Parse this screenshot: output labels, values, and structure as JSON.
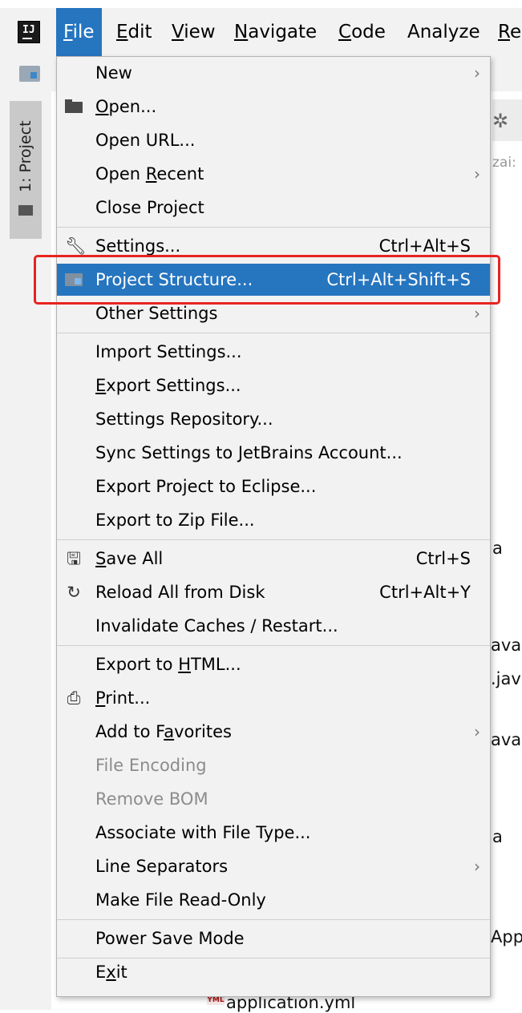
{
  "menubar": {
    "logo": "IJ",
    "items": [
      {
        "label": "File",
        "mnemonic": "F",
        "rest": "ile"
      },
      {
        "label": "Edit",
        "mnemonic": "E",
        "rest": "dit"
      },
      {
        "label": "View",
        "mnemonic": "V",
        "rest": "iew"
      },
      {
        "label": "Navigate",
        "mnemonic": "N",
        "rest": "avigate"
      },
      {
        "label": "Code",
        "mnemonic": "C",
        "rest": "ode"
      },
      {
        "label": "Analyze",
        "mnemonic": "",
        "rest": "Analyze"
      },
      {
        "label": "Re",
        "mnemonic": "R",
        "rest": "e"
      }
    ]
  },
  "side_panel": {
    "tab_label": "1: Project"
  },
  "background": {
    "muted_text": "zai:",
    "fragments": [
      "a",
      "ava",
      ".jav",
      "ava",
      "a",
      "App"
    ],
    "bottom_file": "application.yml",
    "yml_badge": "YML"
  },
  "file_menu": {
    "new": "New",
    "open_pre": "",
    "open_m": "O",
    "open_post": "pen...",
    "open_url": "Open URL...",
    "open_recent_pre": "Open ",
    "open_recent_m": "R",
    "open_recent_post": "ecent",
    "close_project": "Close Project",
    "settings": "Settings...",
    "settings_shortcut": "Ctrl+Alt+S",
    "project_structure": "Project Structure...",
    "project_structure_shortcut": "Ctrl+Alt+Shift+S",
    "other_settings": "Other Settings",
    "import_settings": "Import Settings...",
    "export_settings_m": "E",
    "export_settings_post": "xport Settings...",
    "settings_repository": "Settings Repository...",
    "sync_settings": "Sync Settings to JetBrains Account...",
    "export_eclipse": "Export Project to Eclipse...",
    "export_zip": "Export to Zip File...",
    "save_all_m": "S",
    "save_all_post": "ave All",
    "save_all_shortcut": "Ctrl+S",
    "reload_all": "Reload All from Disk",
    "reload_all_shortcut": "Ctrl+Alt+Y",
    "invalidate_caches": "Invalidate Caches / Restart...",
    "export_html_pre": "Export to ",
    "export_html_m": "H",
    "export_html_post": "TML...",
    "print_m": "P",
    "print_post": "rint...",
    "add_favorites_pre": "Add to F",
    "add_favorites_m": "a",
    "add_favorites_post": "vorites",
    "file_encoding": "File Encoding",
    "remove_bom": "Remove BOM",
    "associate_file_type": "Associate with File Type...",
    "line_separators": "Line Separators",
    "make_read_only": "Make File Read-Only",
    "power_save": "Power Save Mode",
    "exit_pre": "E",
    "exit_m": "x",
    "exit_post": "it"
  },
  "highlight": {
    "color": "#e8231f",
    "target": "Project Structure..."
  },
  "colors": {
    "selection": "#2675bf",
    "menu_bg": "#f2f2f2",
    "disabled_text": "#8c8c8c"
  }
}
